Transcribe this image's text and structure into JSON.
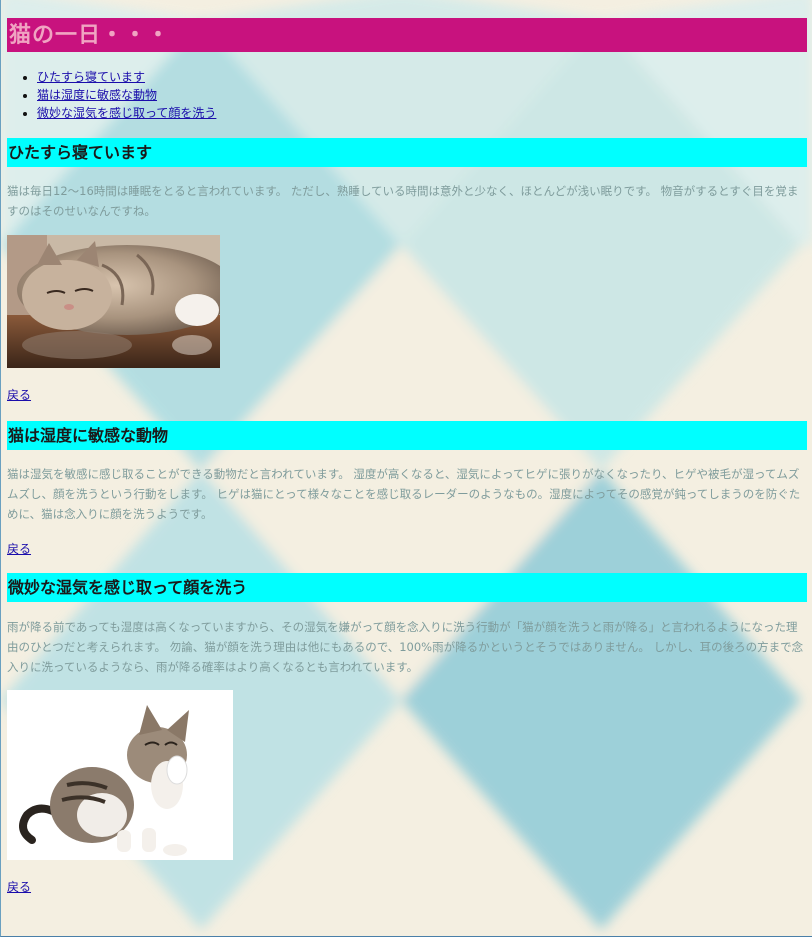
{
  "site_title": "猫の一日・・・",
  "toc": [
    "ひたすら寝ています",
    "猫は湿度に敏感な動物",
    "微妙な湿気を感じ取って顔を洗う"
  ],
  "sections": [
    {
      "heading": "ひたすら寝ています",
      "paragraph": "猫は毎日12〜16時間は睡眠をとると言われています。 ただし、熟睡している時間は意外と少なく、ほとんどが浅い眠りです。 物音がするとすぐ目を覚ますのはそのせいなんですね。",
      "back": "戻る"
    },
    {
      "heading": "猫は湿度に敏感な動物",
      "paragraph": "猫は湿気を敏感に感じ取ることができる動物だと言われています。 湿度が高くなると、湿気によってヒゲに張りがなくなったり、ヒゲや被毛が湿ってムズムズし、顔を洗うという行動をします。 ヒゲは猫にとって様々なことを感じ取るレーダーのようなもの。湿度によってその感覚が鈍ってしまうのを防ぐために、猫は念入りに顔を洗うようです。",
      "back": "戻る"
    },
    {
      "heading": "微妙な湿気を感じ取って顔を洗う",
      "paragraph": "雨が降る前であっても湿度は高くなっていますから、その湿気を嫌がって顔を念入りに洗う行動が「猫が顔を洗うと雨が降る」と言われるようになった理由のひとつだと考えられます。 勿論、猫が顔を洗う理由は他にもあるので、100%雨が降るかというとそうではありません。 しかし、耳の後ろの方まで念入りに洗っているようなら、雨が降る確率はより高くなるとも言われています。",
      "back": "戻る"
    }
  ],
  "colors": {
    "title_bg": "#c8127e",
    "title_text": "#f0a4c2",
    "heading_bg": "#00ffff",
    "paragraph_text": "#7f9c9c",
    "link": "#1a0dab",
    "page_bg": "#f4efe1",
    "diamond_light": "#bfe3e6",
    "diamond_dark": "#8fcbd8"
  }
}
